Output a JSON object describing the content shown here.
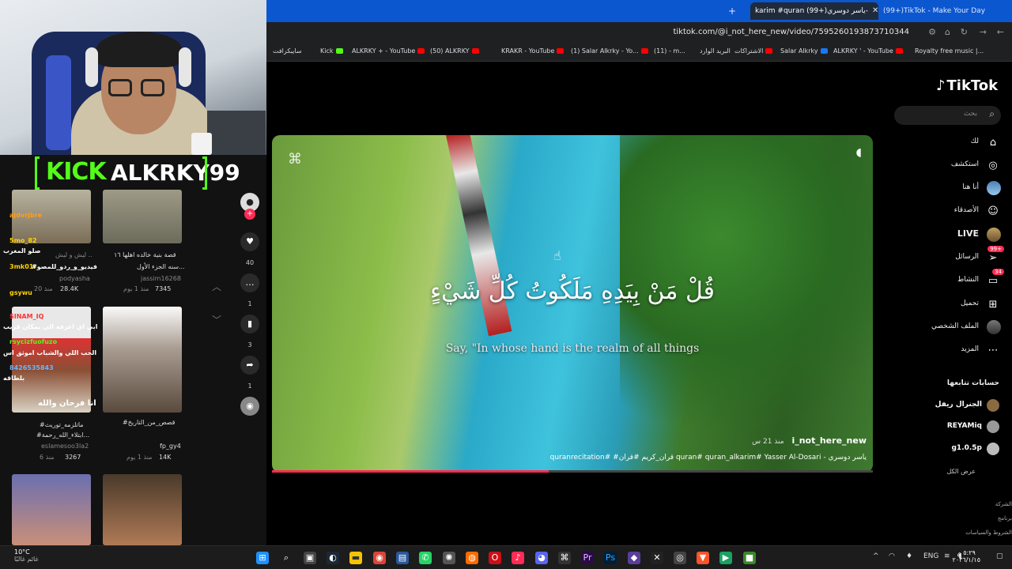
{
  "browser": {
    "tabs": [
      {
        "title": "(99+)TikTok - Make Your Day",
        "active": false
      },
      {
        "title": "karim #quran (99+)ياسر دوسري-",
        "active": true
      }
    ],
    "url": "tiktok.com/@i_not_here_new/video/7595260193873710344",
    "bookmarks": [
      "سايبكرافت",
      "Kick",
      "ALKRKY + - YouTube",
      "(50) ALKRKY",
      "KRAKR - YouTube",
      "(1) Salar Alkrky - Yo...",
      "(11) - m...",
      "البريد الوارد",
      "الاشتراكات",
      "Salar Alkrky",
      "ALKRKY ' - YouTube",
      "Royalty free music |..."
    ]
  },
  "overlay": {
    "kick_logo": "KICK",
    "channel": "ALKRKY99"
  },
  "left_grid": {
    "items": [
      {
        "caption": "ليش و ليش ..",
        "meta": "podyasha",
        "views": "28.4K",
        "ago": "منذ 20"
      },
      {
        "caption": "قصة بنية خالده اهلها ١٦",
        "sub": "سنه الجزء الأول...",
        "meta": "jassim16268",
        "views": "7345",
        "ago": "منذ 1 يوم"
      },
      {
        "caption": "#ماتلزمه_توريث",
        "sub": "#ابتلاء_الله_رحمة...",
        "meta": "eslamesoo3la2",
        "views": "3267",
        "ago": "منذ 6"
      },
      {
        "caption": "#قصص_من_التاريخ",
        "sub": "fp_gy4",
        "views": "14K",
        "ago": "منذ 1 يوم"
      }
    ],
    "chat": [
      {
        "user": "ajdvrjbre",
        "text": ""
      },
      {
        "user": "5mo_82",
        "text": "صلو المغرب"
      },
      {
        "user": "3mk01r",
        "text": "#فيديو_و_ردو_للمصو"
      },
      {
        "user": "gsywu",
        "text": ""
      },
      {
        "user": "SINAM_IQ",
        "text": "ابي اي اعرفه الي يمكان قريب"
      },
      {
        "user": "rsycizfuofuzo",
        "text": "الحب اللي والشباب اموثق اس"
      },
      {
        "user": "8426535843",
        "text": "بلطاقه"
      }
    ],
    "thumb_text": "انا فرحان والله"
  },
  "actions": {
    "likes": "40",
    "comments": "1",
    "saves": "3",
    "shares": "1"
  },
  "video": {
    "arabic_verse": "قُلْ مَنْ بِيَدِهِ مَلَكُوتُ كُلِّ شَيْءٍ",
    "english": "Say, \"In whose hand is the realm of all things",
    "author": "i_not_here_new",
    "ago": "منذ 21 س",
    "description": "quranrecitation# #قران_كريم #قران  quran# quran_alkarim# Yasser Al-Dosari - ياسر دوسري",
    "progress": 0.46
  },
  "tiktok": {
    "logo": "TikTok",
    "search_placeholder": "بحث",
    "nav": [
      {
        "label": "لك",
        "icon": "home-icon"
      },
      {
        "label": "استكشف",
        "icon": "compass-icon"
      },
      {
        "label": "أنا هنا",
        "icon": "avatar-icon"
      },
      {
        "label": "الأصدقاء",
        "icon": "friends-icon"
      },
      {
        "label": "LIVE",
        "icon": "live-icon"
      },
      {
        "label": "الرسائل",
        "icon": "message-icon",
        "badge": "99+"
      },
      {
        "label": "النشاط",
        "icon": "activity-icon",
        "badge": "34"
      },
      {
        "label": "تحميل",
        "icon": "upload-icon"
      },
      {
        "label": "الملف الشخصي",
        "icon": "profile-icon"
      },
      {
        "label": "المزيد",
        "icon": "more-icon"
      }
    ],
    "following_title": "حسابات تتابعها",
    "following": [
      "الجنرال ريفل",
      "REYAMiq",
      "g1.0.5p"
    ],
    "see_all": "عرض الكل",
    "footer": [
      "الشركة",
      "برنامج",
      "الشروط والسياسات"
    ]
  },
  "taskbar": {
    "temp": "10°C",
    "weather": "غائم غالبًا",
    "lang": "ENG",
    "time": "٥:٢٩ م",
    "date": "٢٠٢٦/١/١٥"
  },
  "colors": {
    "tiktok_red": "#fe2c55",
    "kick_green": "#53fc18",
    "tab_bar": "#0b57d0"
  }
}
